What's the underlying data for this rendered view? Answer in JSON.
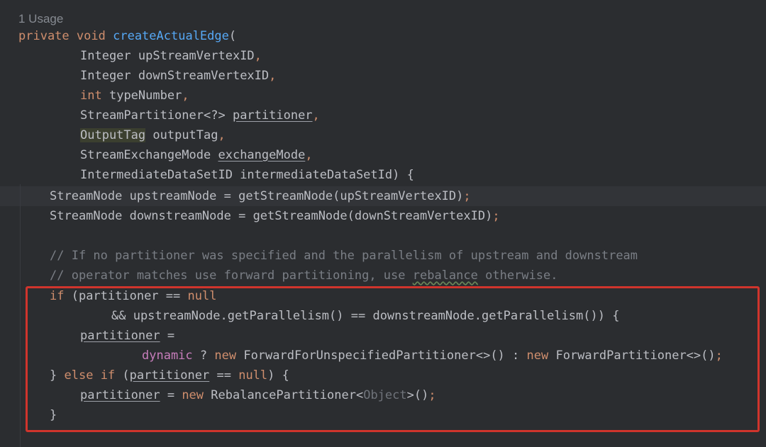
{
  "colors": {
    "background": "#2b2d30",
    "keyword": "#cf8e6d",
    "method": "#56a8f5",
    "field": "#c77dbb",
    "comment": "#7a7e85",
    "text": "#bcbec4",
    "highlight_box": "#d0342c"
  },
  "usage_hint": "1 Usage",
  "code": {
    "l1": {
      "kw_private": "private",
      "kw_void": "void",
      "fn_name": "createActualEdge",
      "paren": "("
    },
    "l2": {
      "type": "Integer",
      "name": "upStreamVertexID",
      "comma": ","
    },
    "l3": {
      "type": "Integer",
      "name": "downStreamVertexID",
      "comma": ","
    },
    "l4": {
      "kw_int": "int",
      "name": "typeNumber",
      "comma": ","
    },
    "l5": {
      "type": "StreamPartitioner<?>",
      "name": "partitioner",
      "comma": ","
    },
    "l6": {
      "type": "OutputTag",
      "name": "outputTag",
      "comma": ","
    },
    "l7": {
      "type": "StreamExchangeMode",
      "name": "exchangeMode",
      "comma": ","
    },
    "l8": {
      "type": "IntermediateDataSetID",
      "name": "intermediateDataSetId",
      "close": ") {"
    },
    "l9": {
      "text": "StreamNode upstreamNode = getStreamNode(upStreamVertexID)",
      "semi": ";"
    },
    "l10": {
      "text": "StreamNode downstreamNode = getStreamNode(downStreamVertexID)",
      "semi": ";"
    },
    "l12": {
      "comment": "// If no partitioner was specified and the parallelism of upstream and downstream"
    },
    "l13": {
      "comment_a": "// operator matches use forward partitioning, use ",
      "comment_word": "rebalance",
      "comment_b": " otherwise."
    },
    "l14": {
      "kw_if": "if",
      "open": " (partitioner == ",
      "kw_null": "null"
    },
    "l15": {
      "text": "&& upstreamNode.getParallelism() == downstreamNode.getParallelism()) {"
    },
    "l16": {
      "var": "partitioner",
      "eq": " ="
    },
    "l17": {
      "fld": "dynamic",
      "t1": " ? ",
      "kw_new1": "new",
      "t2": " ForwardForUnspecifiedPartitioner<>() : ",
      "kw_new2": "new",
      "t3": " ForwardPartitioner<>()",
      "semi": ";"
    },
    "l18": {
      "brace": "} ",
      "kw_else": "else",
      "sp": " ",
      "kw_if": "if",
      "open": " (",
      "var": "partitioner",
      "mid": " == ",
      "kw_null": "null",
      "close": ") {"
    },
    "l19": {
      "var": "partitioner",
      "eq": " = ",
      "kw_new": "new",
      "t1": " RebalancePartitioner<",
      "obj": "Object",
      "t2": ">()",
      "semi": ";"
    },
    "l20": {
      "brace": "}"
    }
  }
}
